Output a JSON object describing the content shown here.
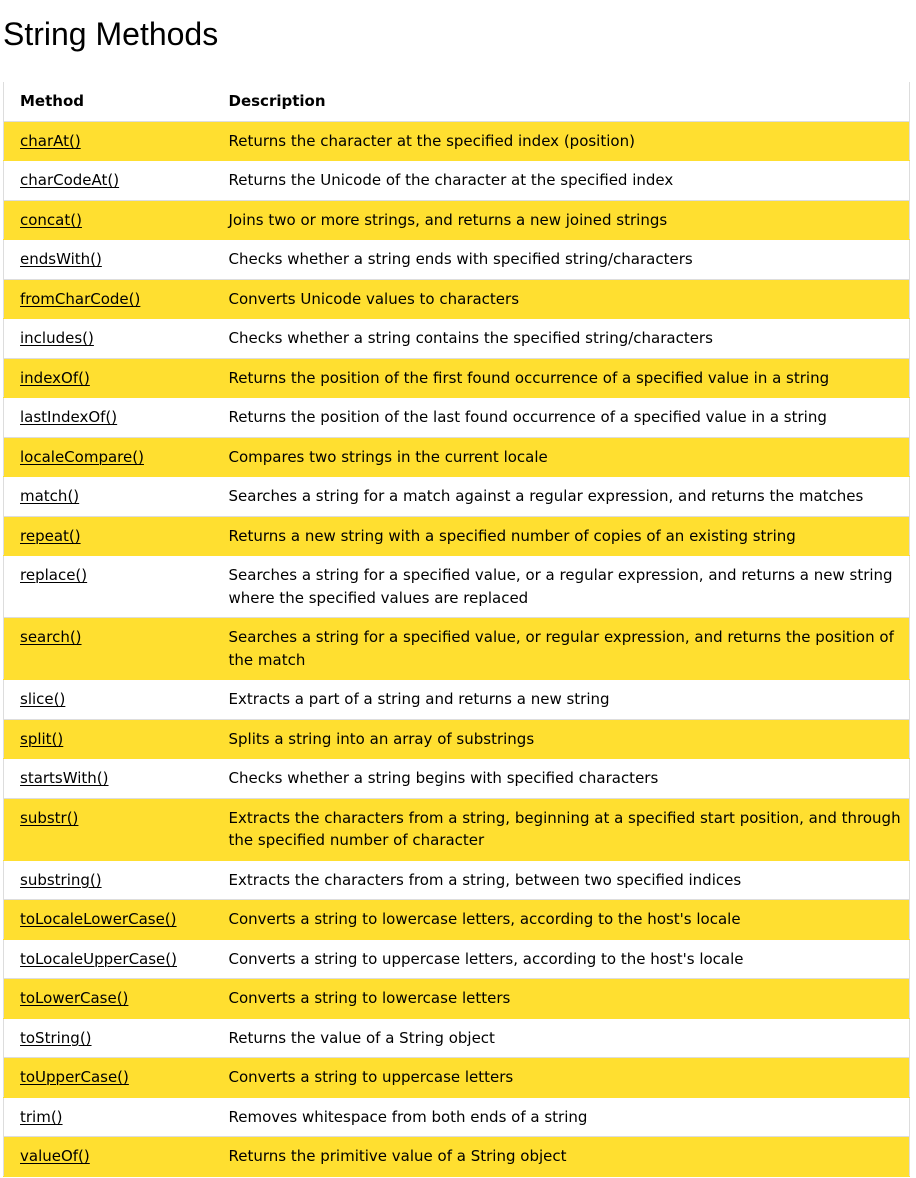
{
  "page": {
    "title": "String Methods"
  },
  "table": {
    "headers": {
      "method": "Method",
      "description": "Description"
    },
    "rows": [
      {
        "method": "charAt()",
        "description": "Returns the character at the specified index (position)"
      },
      {
        "method": "charCodeAt()",
        "description": "Returns the Unicode of the character at the specified index"
      },
      {
        "method": "concat()",
        "description": "Joins two or more strings, and returns a new joined strings"
      },
      {
        "method": "endsWith()",
        "description": "Checks whether a string ends with specified string/characters"
      },
      {
        "method": "fromCharCode()",
        "description": "Converts Unicode values to characters"
      },
      {
        "method": "includes()",
        "description": "Checks whether a string contains the specified string/characters"
      },
      {
        "method": "indexOf()",
        "description": "Returns the position of the first found occurrence of a specified value in a string"
      },
      {
        "method": "lastIndexOf()",
        "description": "Returns the position of the last found occurrence of a specified value in a string"
      },
      {
        "method": "localeCompare()",
        "description": "Compares two strings in the current locale"
      },
      {
        "method": "match()",
        "description": "Searches a string for a match against a regular expression, and returns the matches"
      },
      {
        "method": "repeat()",
        "description": "Returns a new string with a specified number of copies of an existing string"
      },
      {
        "method": "replace()",
        "description": "Searches a string for a specified value, or a regular expression, and returns a new string where the specified values are replaced"
      },
      {
        "method": "search()",
        "description": "Searches a string for a specified value, or regular expression, and returns the position of the match"
      },
      {
        "method": "slice()",
        "description": "Extracts a part of a string and returns a new string"
      },
      {
        "method": "split()",
        "description": "Splits a string into an array of substrings"
      },
      {
        "method": "startsWith()",
        "description": "Checks whether a string begins with specified characters"
      },
      {
        "method": "substr()",
        "description": "Extracts the characters from a string, beginning at a specified start position, and through the specified number of character"
      },
      {
        "method": "substring()",
        "description": "Extracts the characters from a string, between two specified indices"
      },
      {
        "method": "toLocaleLowerCase()",
        "description": "Converts a string to lowercase letters, according to the host's locale"
      },
      {
        "method": "toLocaleUpperCase()",
        "description": "Converts a string to uppercase letters, according to the host's locale"
      },
      {
        "method": "toLowerCase()",
        "description": "Converts a string to lowercase letters"
      },
      {
        "method": "toString()",
        "description": "Returns the value of a String object"
      },
      {
        "method": "toUpperCase()",
        "description": "Converts a string to uppercase letters"
      },
      {
        "method": "trim()",
        "description": "Removes whitespace from both ends of a string"
      },
      {
        "method": "valueOf()",
        "description": "Returns the primitive value of a String object"
      }
    ]
  },
  "colors": {
    "highlight_row": "#ffdf30",
    "plain_row": "#ffffff",
    "border": "#dddddd",
    "text": "#000000"
  }
}
